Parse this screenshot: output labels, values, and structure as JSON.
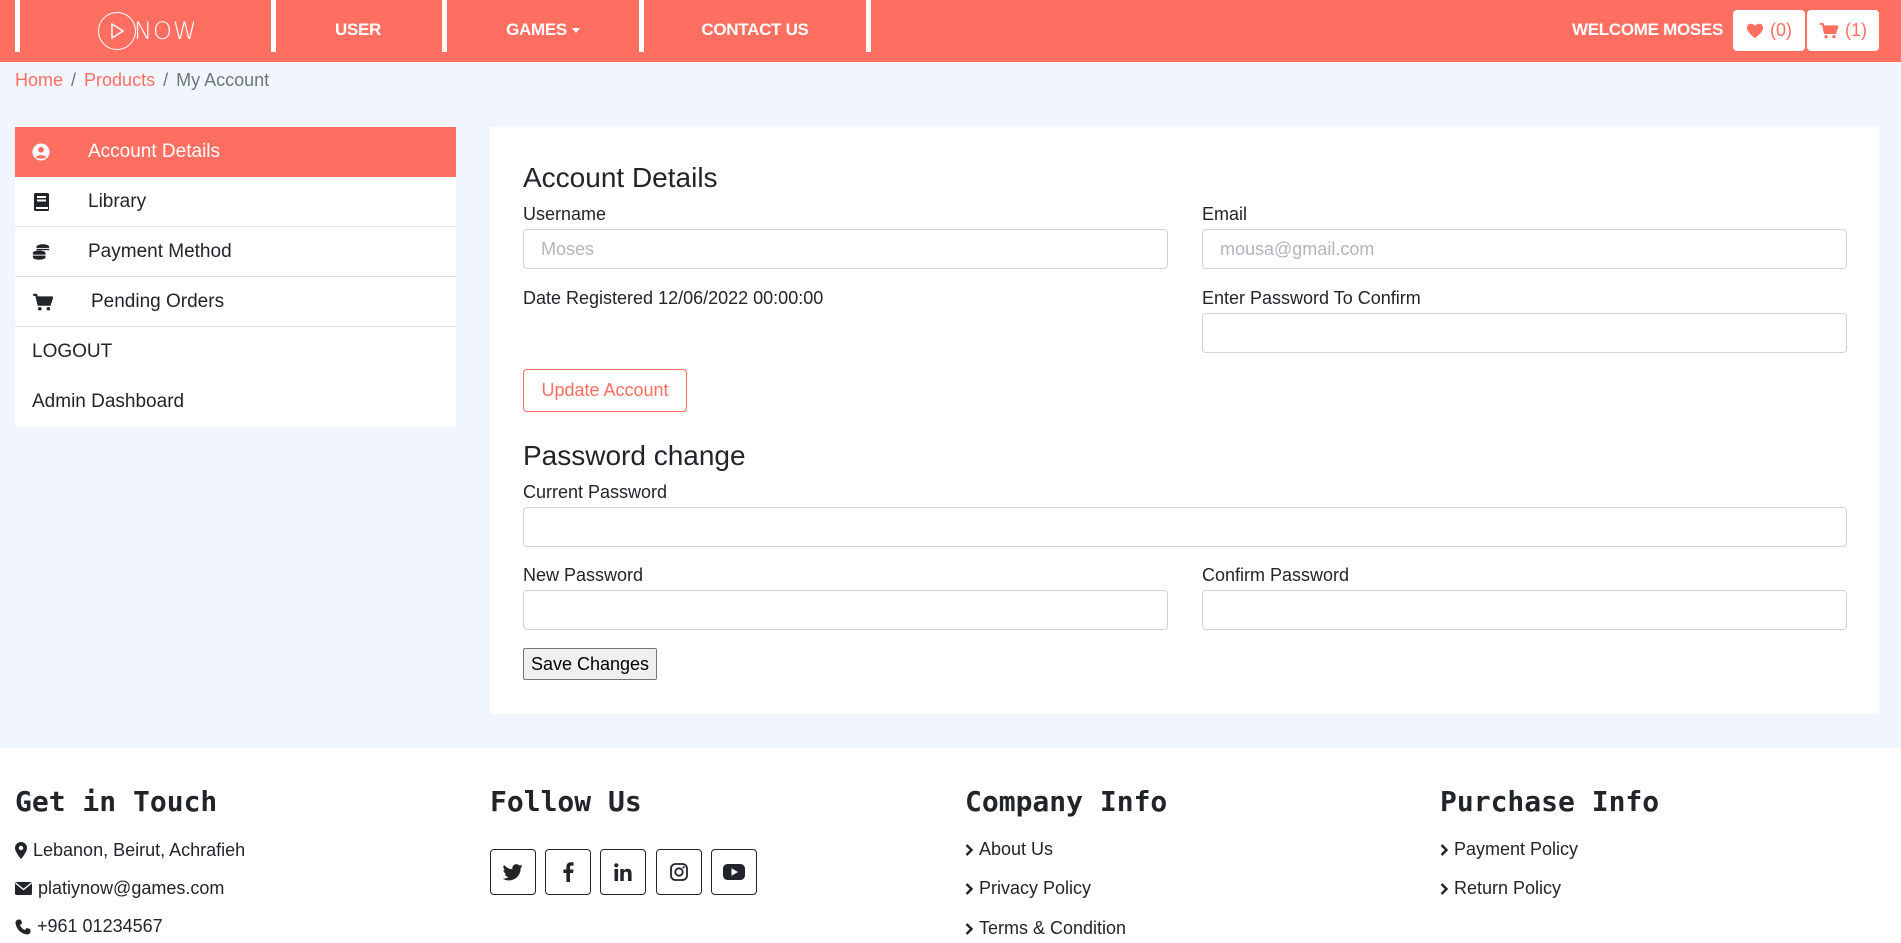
{
  "nav": {
    "logo_text": "NOW",
    "links": [
      "USER",
      "GAMES",
      "CONTACT US"
    ],
    "welcome": "WELCOME MOSES",
    "wishlist_count": "(0)",
    "cart_count": "(1)"
  },
  "breadcrumb": {
    "home": "Home",
    "products": "Products",
    "current": "My Account",
    "separator": "/"
  },
  "sidebar": {
    "items": [
      "Account Details",
      "Library",
      "Payment Method",
      "Pending Orders",
      "LOGOUT",
      "Admin Dashboard"
    ]
  },
  "account": {
    "title": "Account Details",
    "username_label": "Username",
    "username_placeholder": "Moses",
    "email_label": "Email",
    "email_placeholder": "mousa@gmail.com",
    "date_registered": "Date Registered 12/06/2022 00:00:00",
    "confirm_label": "Enter Password To Confirm",
    "update_button": "Update Account"
  },
  "password": {
    "title": "Password change",
    "current_label": "Current Password",
    "new_label": "New Password",
    "confirm_label": "Confirm Password",
    "save_button": "Save Changes"
  },
  "footer": {
    "touch": {
      "title": "Get in Touch",
      "address": "Lebanon, Beirut, Achrafieh",
      "email": "platiynow@games.com",
      "phone": "+961 01234567"
    },
    "follow": {
      "title": "Follow Us"
    },
    "company": {
      "title": "Company Info",
      "links": [
        "About Us",
        "Privacy Policy",
        "Terms & Condition"
      ]
    },
    "purchase": {
      "title": "Purchase Info",
      "links": [
        "Payment Policy",
        "Return Policy"
      ]
    }
  },
  "colors": {
    "accent": "#ff6f61",
    "page_bg": "#f1f5fe"
  }
}
